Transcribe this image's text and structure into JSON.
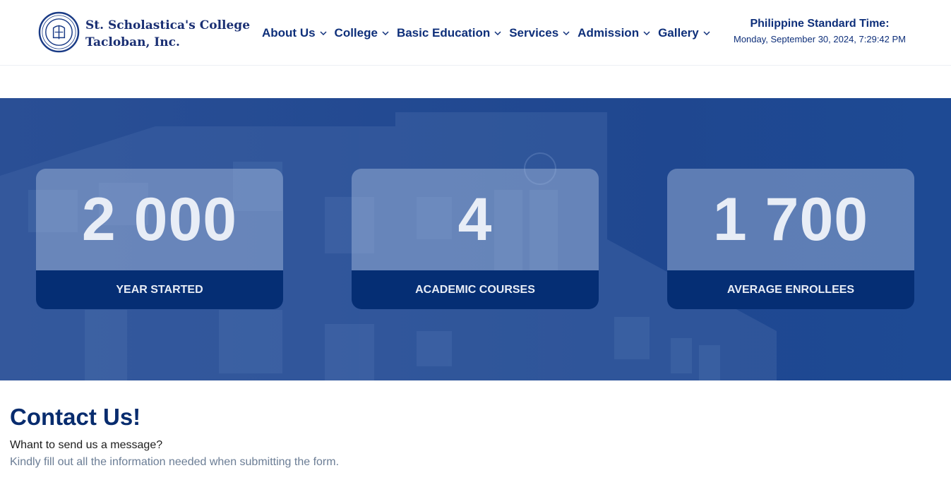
{
  "brand": {
    "line1": "St. Scholastica's College",
    "line2": "Tacloban, Inc.",
    "logo_icon": "college-seal-icon"
  },
  "nav": {
    "items": [
      {
        "label": "About Us"
      },
      {
        "label": "College"
      },
      {
        "label": "Basic Education"
      },
      {
        "label": "Services"
      },
      {
        "label": "Admission"
      },
      {
        "label": "Gallery"
      }
    ]
  },
  "time": {
    "title": "Philippine Standard Time:",
    "value": "Monday, September 30, 2024, 7:29:42 PM"
  },
  "stats": [
    {
      "value": "2 000",
      "label": "YEAR STARTED"
    },
    {
      "value": "4",
      "label": "ACADEMIC COURSES"
    },
    {
      "value": "1 700",
      "label": "AVERAGE ENROLLEES"
    }
  ],
  "contact": {
    "title": "Contact Us!",
    "question": "Whant to send us a message?",
    "description": "Kindly fill out all the information needed when submitting the form."
  },
  "colors": {
    "primary": "#0e2f7a",
    "stat_label_bg": "#052e74",
    "hero_overlay": "#234a92"
  }
}
